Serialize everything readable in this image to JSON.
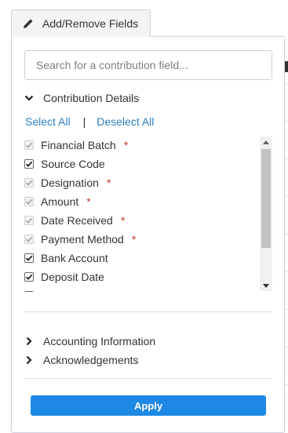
{
  "trigger": {
    "label": "Add/Remove Fields",
    "icon": "pencil-icon"
  },
  "search": {
    "placeholder": "Search for a contribution field..."
  },
  "contribution_section": {
    "label": "Contribution Details",
    "expanded": true
  },
  "select_all": "Select All",
  "separator": "|",
  "deselect_all": "Deselect All",
  "fields": [
    {
      "label": "Financial Batch",
      "required": true,
      "checked": true,
      "disabled": true
    },
    {
      "label": "Source Code",
      "required": false,
      "checked": true,
      "disabled": false
    },
    {
      "label": "Designation",
      "required": true,
      "checked": true,
      "disabled": true
    },
    {
      "label": "Amount",
      "required": true,
      "checked": true,
      "disabled": true
    },
    {
      "label": "Date Received",
      "required": true,
      "checked": true,
      "disabled": true
    },
    {
      "label": "Payment Method",
      "required": true,
      "checked": true,
      "disabled": true
    },
    {
      "label": "Bank Account",
      "required": false,
      "checked": true,
      "disabled": false
    },
    {
      "label": "Deposit Date",
      "required": false,
      "checked": true,
      "disabled": false
    },
    {
      "label": "Deposit Number",
      "required": false,
      "checked": false,
      "disabled": false
    }
  ],
  "required_marker": "*",
  "collapsed_sections": [
    {
      "label": "Accounting Information"
    },
    {
      "label": "Acknowledgements"
    }
  ],
  "apply_label": "Apply",
  "colors": {
    "accent": "#1e88e5",
    "link": "#2f7fc1",
    "required": "#c0392b"
  }
}
